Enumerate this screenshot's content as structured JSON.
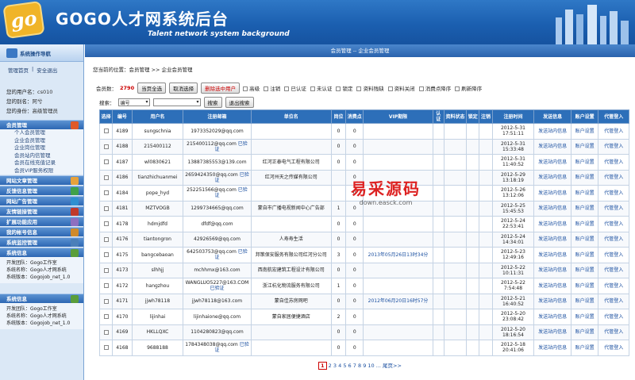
{
  "header": {
    "logo_text": "go",
    "title": "GOGO人才网系统后台",
    "subtitle": "Talent network system background"
  },
  "sidebar": {
    "nav_title": "系统操作导航",
    "quick_links": [
      "管理首页",
      "|",
      "安全退出"
    ],
    "user": {
      "name_label": "您的用户名：",
      "name": "cs010",
      "alias_label": "您的别名：",
      "alias": "阿兮",
      "role_label": "您的身份：",
      "role": "高级管理员"
    },
    "sections": [
      {
        "label": "会员管理",
        "color": "#e05a2a",
        "subs": [
          "个人会员管理",
          "企业会员管理",
          "企业岗位管理",
          "会员站内信管理",
          "会员在线充值记录",
          "会员VIP服务权限"
        ]
      },
      {
        "label": "网站文章管理",
        "color": "#e7a23c"
      },
      {
        "label": "反馈信息管理",
        "color": "#3fa14a"
      },
      {
        "label": "网站广告管理",
        "color": "#2f8fd0"
      },
      {
        "label": "友情链接管理",
        "color": "#c0392b"
      },
      {
        "label": "扩展功能应用",
        "color": "#8e6fc0"
      },
      {
        "label": "我的帐号信息",
        "color": "#d08a2a"
      },
      {
        "label": "系统监控管理",
        "color": "#4a7fb9"
      },
      {
        "label": "系统信息",
        "color": "#5a9e3a"
      }
    ],
    "sysinfo1": {
      "team": "开发团队：Gogo工作室",
      "name": "系统名称：Gogo人才网系统",
      "ver": "系统版本：Gogojob_net_1.0"
    },
    "sysinfo2_title": "系统信息",
    "sysinfo2": {
      "team": "开发团队：Gogo工作室",
      "name": "系统名称：Gogo人才网系统",
      "ver": "系统版本：Gogojob_net_1.0"
    }
  },
  "main": {
    "bar_title": "会员管理 -- 企业会员管理",
    "crumb": "您当前的位置：会员管理 >> 企业会员管理",
    "count_label": "会员数：",
    "count": "2790",
    "btn_all": "当页全选",
    "btn_cancel": "取消选择",
    "btn_delete": "删除选中用户",
    "filters": [
      "高级",
      "注销",
      "已认证",
      "未认证",
      "锁定",
      "资料残缺",
      "资料关闭",
      "消费点降序",
      "刷新降序"
    ],
    "search_label": "搜索：",
    "search_field": "编号",
    "btn_search": "搜索",
    "btn_exit": "退出搜索",
    "columns": [
      "选择",
      "编号",
      "用户名",
      "注册邮箱",
      "单位名",
      "岗位",
      "消费点",
      "VIP期限",
      "认证",
      "资料状态",
      "锁定",
      "注销",
      "注册时间",
      "发送信息",
      "账户设置",
      "代管登入"
    ],
    "rows": [
      {
        "id": "4189",
        "user": "sungschnia",
        "email": "1973352029@qq.com",
        "cert": "",
        "unit": "",
        "jobs": "0",
        "points": "0",
        "vip": "",
        "time": "2012-5-31 17:51:11"
      },
      {
        "id": "4188",
        "user": "215400112",
        "email": "215400112@qq.com",
        "cert": "已验证",
        "unit": "",
        "jobs": "0",
        "points": "0",
        "vip": "",
        "time": "2012-5-31 15:33:48"
      },
      {
        "id": "4187",
        "user": "wl0830621",
        "email": "13887385553@139.com",
        "cert": "",
        "unit": "红河正泰电气工程有限公司",
        "jobs": "0",
        "points": "0",
        "vip": "",
        "time": "2012-5-31 11:40:52"
      },
      {
        "id": "4186",
        "user": "tianzhichuanmei",
        "email": "2659424350@qq.com",
        "cert": "已验证",
        "unit": "红河州天之传媒有限公司",
        "jobs": "",
        "points": "0",
        "vip": "",
        "time": "2012-5-29 13:18:19"
      },
      {
        "id": "4184",
        "user": "pope_hyd",
        "email": "252251566@qq.com",
        "cert": "已验证",
        "unit": "",
        "jobs": "",
        "points": "0",
        "vip": "",
        "time": "2012-5-26 13:12:06"
      },
      {
        "id": "4181",
        "user": "MZTVOGB",
        "email": "1299734665@qq.com",
        "cert": "",
        "unit": "蒙自市广播电视新闻中心广告部",
        "jobs": "1",
        "points": "0",
        "vip": "",
        "time": "2012-5-25 15:45:53"
      },
      {
        "id": "4178",
        "user": "hdmjdfd",
        "email": "dfdf@qq.com",
        "cert": "",
        "unit": "",
        "jobs": "0",
        "points": "0",
        "vip": "",
        "time": "2012-5-24 22:53:41"
      },
      {
        "id": "4176",
        "user": "tiantongron",
        "email": "42926569@qq.com",
        "cert": "",
        "unit": "人寿寿生活",
        "jobs": "0",
        "points": "0",
        "vip": "",
        "time": "2012-5-24 14:34:01"
      },
      {
        "id": "4175",
        "user": "bangcebaoan",
        "email": "642503753@qq.com",
        "cert": "已验证",
        "unit": "邦策保安服务有限公司红河分公司",
        "jobs": "3",
        "points": "0",
        "vip": "2013年05月26日13时34分",
        "time": "2012-5-23 12:49:16"
      },
      {
        "id": "4173",
        "user": "slhhjj",
        "email": "mchhmx@163.com",
        "cert": "",
        "unit": "西南航宏建筑工程设计有限公司",
        "jobs": "0",
        "points": "0",
        "vip": "",
        "time": "2012-5-22 10:11:31"
      },
      {
        "id": "4172",
        "user": "hangzhou",
        "email": "WANGLUO5227@163.COM",
        "cert": "已验证",
        "unit": "浙江杭化物流服务有限公司",
        "jobs": "1",
        "points": "0",
        "vip": "",
        "time": "2012-5-22 7:54:48"
      },
      {
        "id": "4171",
        "user": "jjwh78118",
        "email": "jjwh78118@163.com",
        "cert": "",
        "unit": "蒙自佳苏房网吧",
        "jobs": "0",
        "points": "0",
        "vip": "2012年06月20日16时57分",
        "time": "2012-5-21 16:40:52"
      },
      {
        "id": "4170",
        "user": "lijinhai",
        "email": "lijinhaione@qq.com",
        "cert": "",
        "unit": "蒙自家居便捷酒店",
        "jobs": "2",
        "points": "0",
        "vip": "",
        "time": "2012-5-20 23:08:42"
      },
      {
        "id": "4169",
        "user": "HKLLQXC",
        "email": "1104280823@qq.com",
        "cert": "",
        "unit": "",
        "jobs": "0",
        "points": "0",
        "vip": "",
        "time": "2012-5-20 18:16:54"
      },
      {
        "id": "4168",
        "user": "9688188",
        "email": "1784348038@qq.com",
        "cert": "已验证",
        "unit": "",
        "jobs": "0",
        "points": "0",
        "vip": "",
        "time": "2012-5-18 20:41:06"
      }
    ],
    "row_send": "发送站内信息",
    "row_account": "账户设置",
    "row_proxy": "代管登入",
    "pager_current": "1",
    "pager_pages": [
      "2",
      "3",
      "4",
      "5",
      "6",
      "7",
      "8",
      "9",
      "10"
    ],
    "pager_more": "...",
    "pager_last": "尾页>>",
    "watermark1": "易采源码",
    "watermark2": "down.easck.com"
  }
}
